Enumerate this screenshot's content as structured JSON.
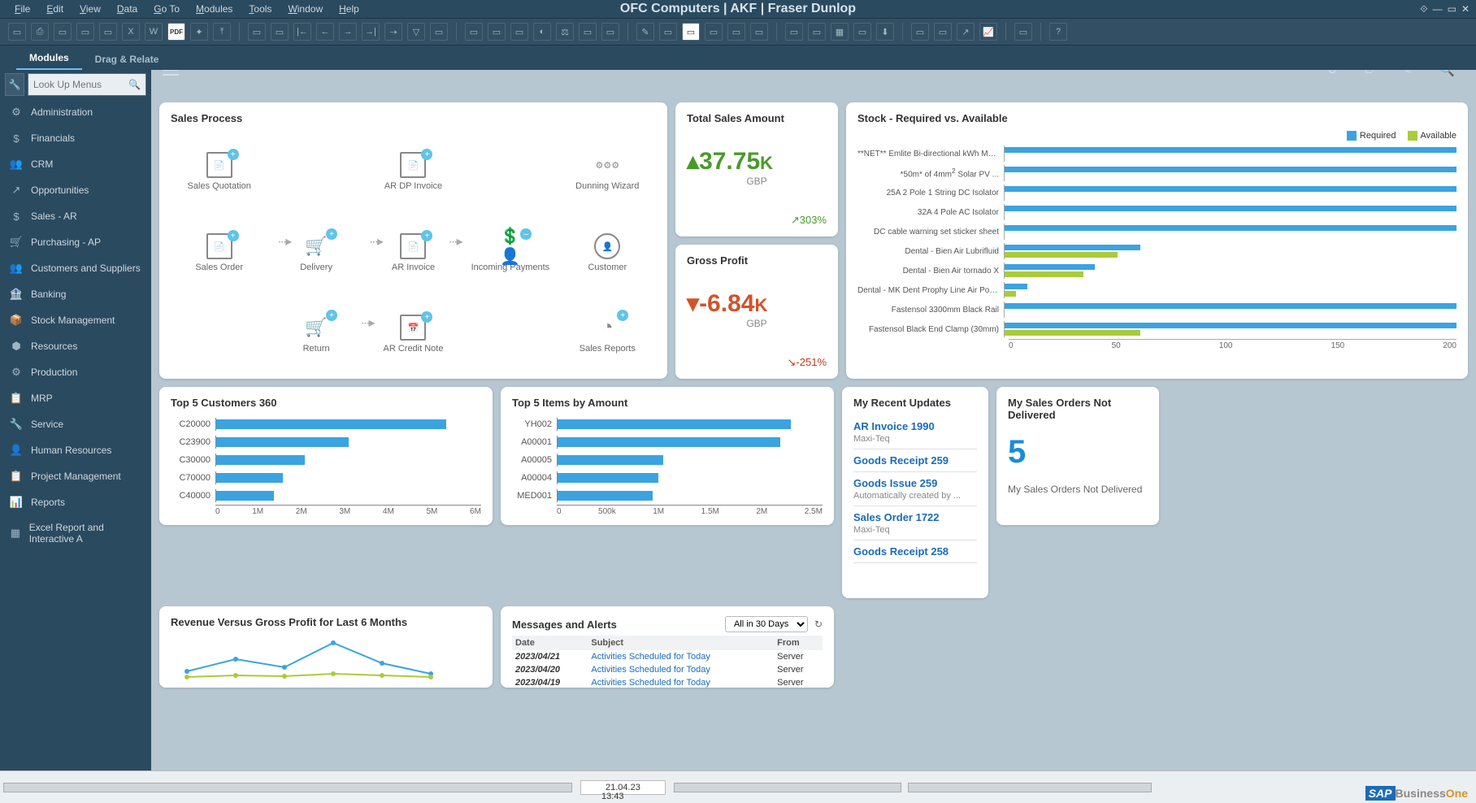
{
  "app_title": "OFC Computers | AKF | Fraser Dunlop",
  "menus": [
    "File",
    "Edit",
    "View",
    "Data",
    "Go To",
    "Modules",
    "Tools",
    "Window",
    "Help"
  ],
  "tabs": {
    "modules": "Modules",
    "drag": "Drag & Relate"
  },
  "search_placeholder": "Look Up Menus",
  "nav": [
    "Administration",
    "Financials",
    "CRM",
    "Opportunities",
    "Sales - AR",
    "Purchasing - AP",
    "Customers and Suppliers",
    "Banking",
    "Stock Management",
    "Resources",
    "Production",
    "MRP",
    "Service",
    "Human Resources",
    "Project Management",
    "Reports",
    "Excel Report and Interactive A"
  ],
  "sales_process": {
    "title": "Sales Process",
    "nodes": {
      "quote": "Sales Quotation",
      "dp": "AR DP Invoice",
      "dunning": "Dunning Wizard",
      "order": "Sales Order",
      "delivery": "Delivery",
      "invoice": "AR Invoice",
      "incoming": "Incoming Payments",
      "customer": "Customer",
      "return": "Return",
      "credit": "AR Credit Note",
      "reports": "Sales Reports"
    }
  },
  "kpi_sales": {
    "title": "Total Sales Amount",
    "value": "37.75",
    "unit": "K",
    "currency": "GBP",
    "delta": "303%",
    "arrow": "↗"
  },
  "kpi_profit": {
    "title": "Gross Profit",
    "value": "-6.84",
    "unit": "K",
    "currency": "GBP",
    "delta": "-251%",
    "arrow": "↘"
  },
  "stock": {
    "title": "Stock - Required vs. Available",
    "legend_req": "Required",
    "legend_av": "Available",
    "axis": [
      "0",
      "50",
      "100",
      "150",
      "200"
    ]
  },
  "top_customers": {
    "title": "Top 5 Customers 360",
    "axis": [
      "0",
      "1M",
      "2M",
      "3M",
      "4M",
      "5M",
      "6M"
    ]
  },
  "top_items": {
    "title": "Top 5 Items by Amount",
    "axis": [
      "0",
      "500k",
      "1M",
      "1.5M",
      "2M",
      "2.5M"
    ]
  },
  "updates": {
    "title": "My Recent Updates",
    "items": [
      {
        "link": "AR Invoice 1990",
        "sub": "Maxi-Teq"
      },
      {
        "link": "Goods Receipt 259",
        "sub": ""
      },
      {
        "link": "Goods Issue 259",
        "sub": "Automatically created by ..."
      },
      {
        "link": "Sales Order 1722",
        "sub": "Maxi-Teq"
      },
      {
        "link": "Goods Receipt 258",
        "sub": ""
      }
    ]
  },
  "not_delivered": {
    "title": "My Sales Orders Not Delivered",
    "value": "5",
    "caption": "My Sales Orders Not Delivered"
  },
  "revenue": {
    "title": "Revenue Versus Gross Profit for Last 6 Months"
  },
  "messages": {
    "title": "Messages and Alerts",
    "filter": "All in 30 Days",
    "cols": {
      "date": "Date",
      "subject": "Subject",
      "from": "From"
    },
    "rows": [
      {
        "date": "2023/04/21",
        "subject": "Activities Scheduled for Today",
        "from": "Server"
      },
      {
        "date": "2023/04/20",
        "subject": "Activities Scheduled for Today",
        "from": "Server"
      },
      {
        "date": "2023/04/19",
        "subject": "Activities Scheduled for Today",
        "from": "Server"
      }
    ]
  },
  "status": {
    "date": "21.04.23",
    "time": "13:43"
  },
  "chart_data": {
    "stock": {
      "type": "bar",
      "orientation": "horizontal",
      "categories": [
        "**NET** Emlite Bi-directional kWh Mete...",
        "*50m* of 4mm<sup>2</sup> Solar PV ...",
        "25A 2 Pole 1 String DC Isolator",
        "32A 4 Pole AC Isolator",
        "DC cable warning set sticker sheet",
        "Dental - Bien Air Lubrifluid",
        "Dental - Bien Air tornado X",
        "Dental - MK Dent Prophy Line Air Polis...",
        "Fastensol 3300mm Black Rail",
        "Fastensol Black End Clamp (30mm)"
      ],
      "series": [
        {
          "name": "Required",
          "values": [
            200,
            200,
            200,
            200,
            200,
            60,
            40,
            10,
            200,
            200
          ]
        },
        {
          "name": "Available",
          "values": [
            0,
            0,
            0,
            0,
            0,
            50,
            35,
            5,
            0,
            60
          ]
        }
      ],
      "xlim": [
        0,
        200
      ]
    },
    "top_customers": {
      "type": "bar",
      "orientation": "horizontal",
      "categories": [
        "C20000",
        "C23900",
        "C30000",
        "C70000",
        "C40000"
      ],
      "values": [
        5.2,
        3.0,
        2.0,
        1.5,
        1.3
      ],
      "unit": "M",
      "xlim": [
        0,
        6
      ]
    },
    "top_items": {
      "type": "bar",
      "orientation": "horizontal",
      "categories": [
        "YH002",
        "A00001",
        "A00005",
        "A00004",
        "MED001"
      ],
      "values": [
        2.2,
        2.1,
        1.0,
        0.95,
        0.9
      ],
      "unit": "M",
      "xlim": [
        0,
        2.5
      ]
    },
    "revenue": {
      "type": "line",
      "x": [
        1,
        2,
        3,
        4,
        5,
        6
      ],
      "series": [
        {
          "name": "Revenue",
          "values": [
            20,
            35,
            25,
            55,
            30,
            18
          ],
          "color": "#3ba3e0"
        },
        {
          "name": "Gross Profit",
          "values": [
            8,
            10,
            9,
            12,
            10,
            8
          ],
          "color": "#a9cc3a"
        }
      ]
    }
  }
}
